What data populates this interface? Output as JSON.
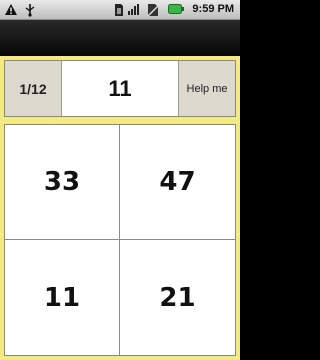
{
  "status_bar": {
    "time": "9:59 PM",
    "icons": [
      "warning-icon",
      "usb-icon",
      "sd-card-icon",
      "signal-icon",
      "no-sim-icon",
      "battery-icon"
    ]
  },
  "game": {
    "progress": "1/12",
    "target": "11",
    "help_label": "Help me",
    "tiles": [
      "33",
      "47",
      "11",
      "21"
    ]
  },
  "colors": {
    "background": "#f3ea84",
    "battery": "#39b54a"
  }
}
